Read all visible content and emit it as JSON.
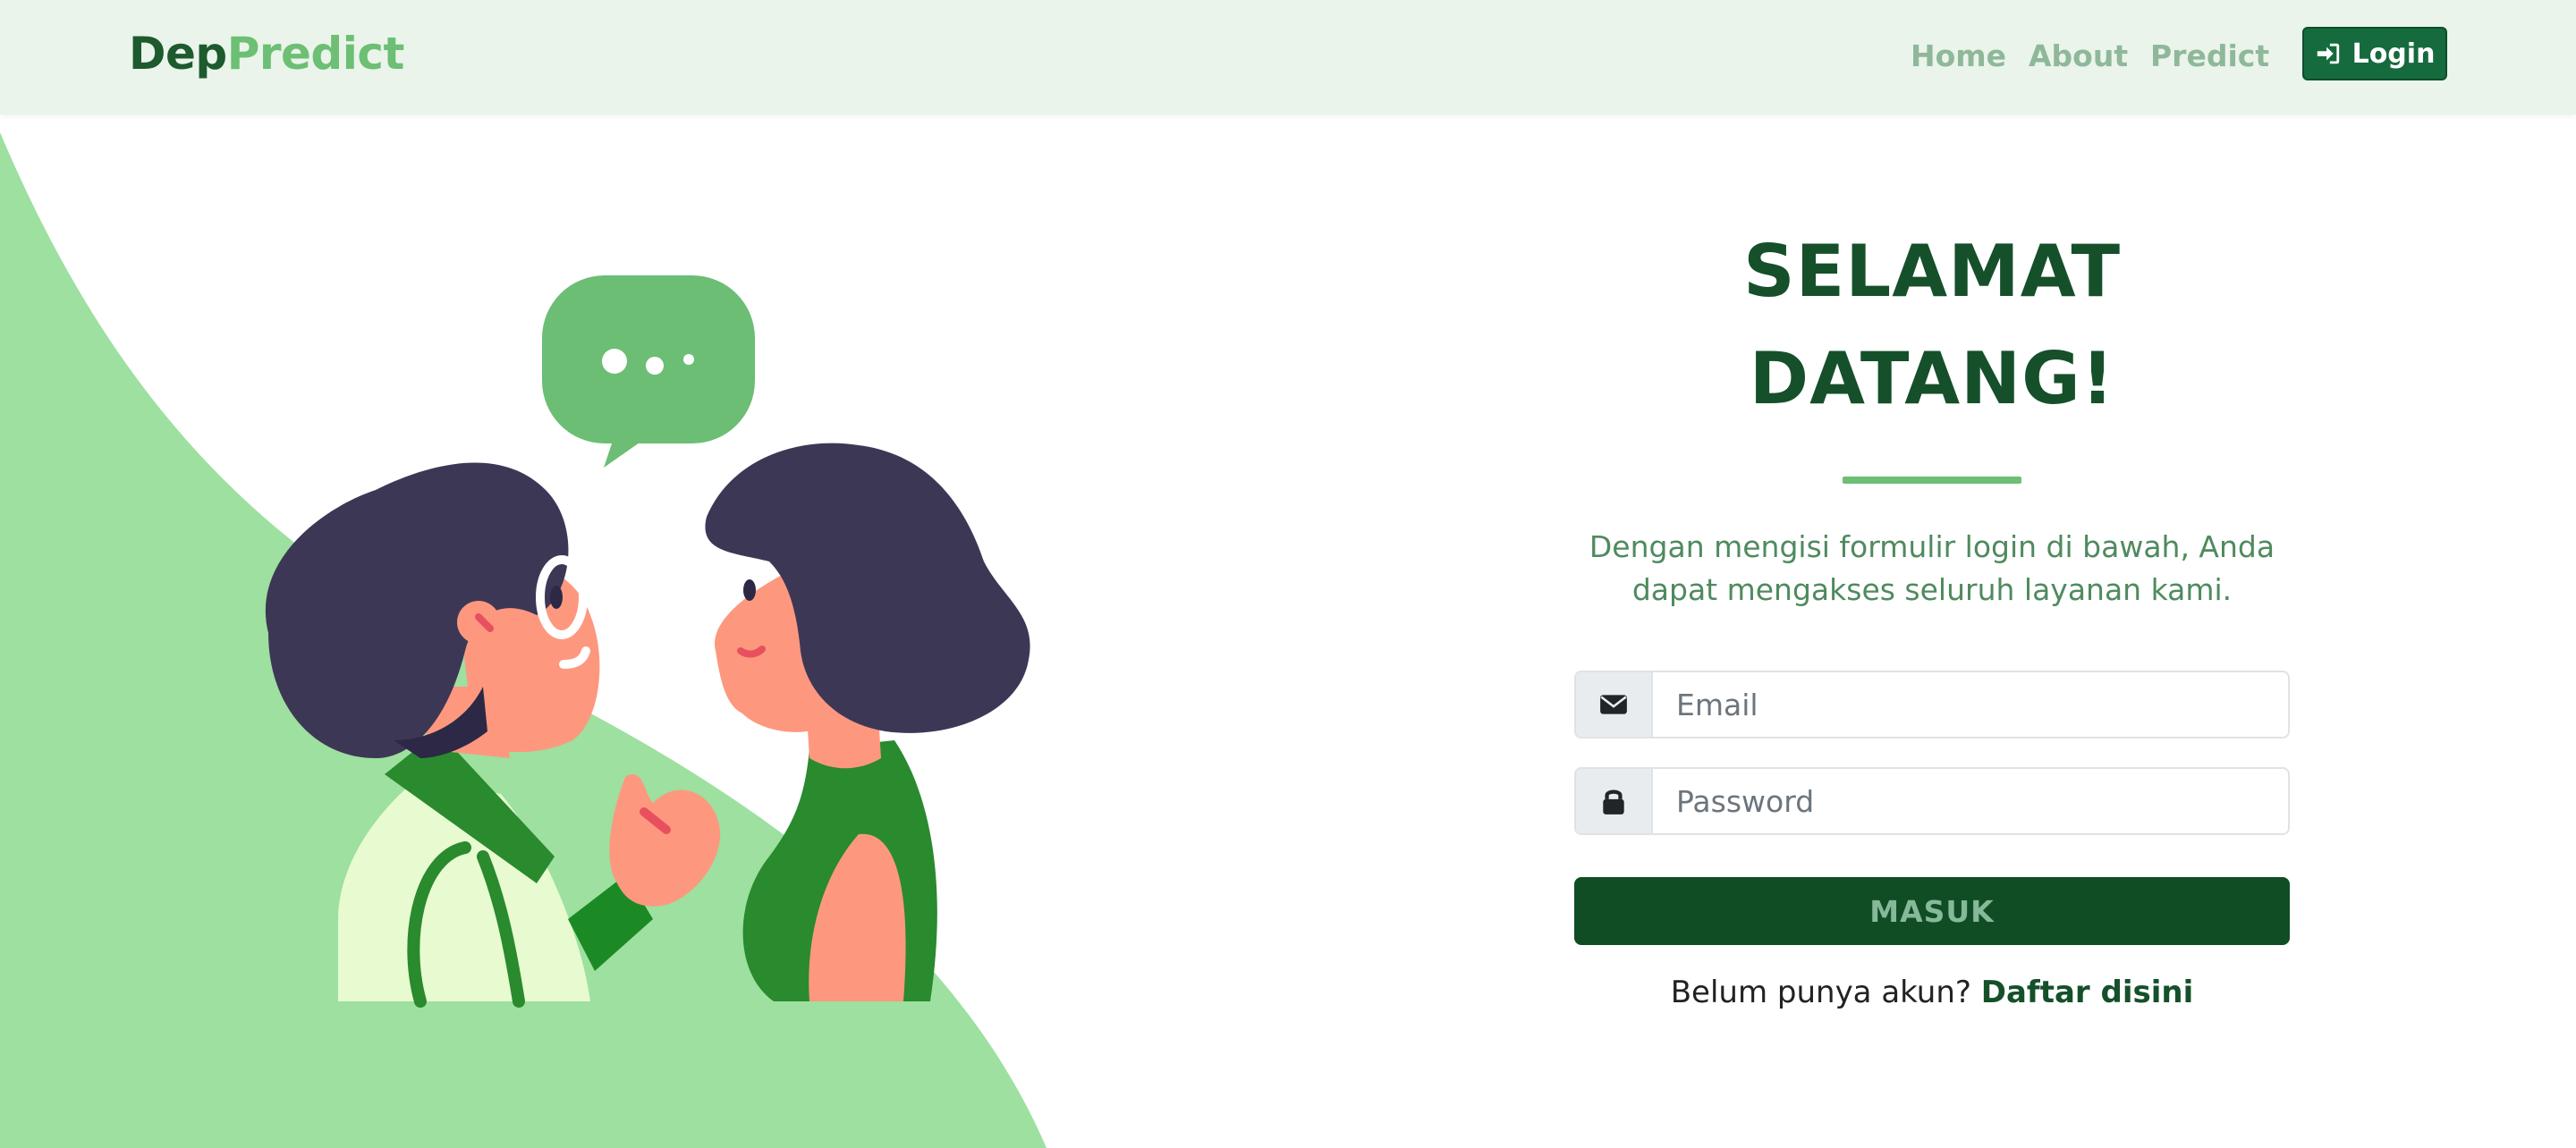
{
  "brand": {
    "part1": "Dep",
    "part2": "Predict"
  },
  "nav": {
    "items": [
      {
        "label": "Home"
      },
      {
        "label": "About"
      },
      {
        "label": "Predict"
      }
    ],
    "login": {
      "label": "Login",
      "icon": "sign-in-icon"
    }
  },
  "hero": {
    "title_line1": "SELAMAT",
    "title_line2": "DATANG!",
    "lead": "Dengan mengisi formulir login di bawah, Anda dapat mengakses seluruh layanan kami."
  },
  "form": {
    "email": {
      "placeholder": "Email",
      "value": "",
      "icon": "envelope-icon"
    },
    "password": {
      "placeholder": "Password",
      "value": "",
      "icon": "lock-icon"
    },
    "submit": {
      "label": "MASUK"
    },
    "register_prompt": "Belum punya akun?",
    "register_link": "Daftar disini"
  },
  "colors": {
    "navbar_bg": "#eaf4ea",
    "brand_dark": "#1d5a2d",
    "brand_light": "#6cbf74",
    "primary_dark": "#114d24",
    "login_btn": "#156b3e",
    "illustration_green": "#9de09f",
    "speech_bubble": "#6cbe74"
  }
}
